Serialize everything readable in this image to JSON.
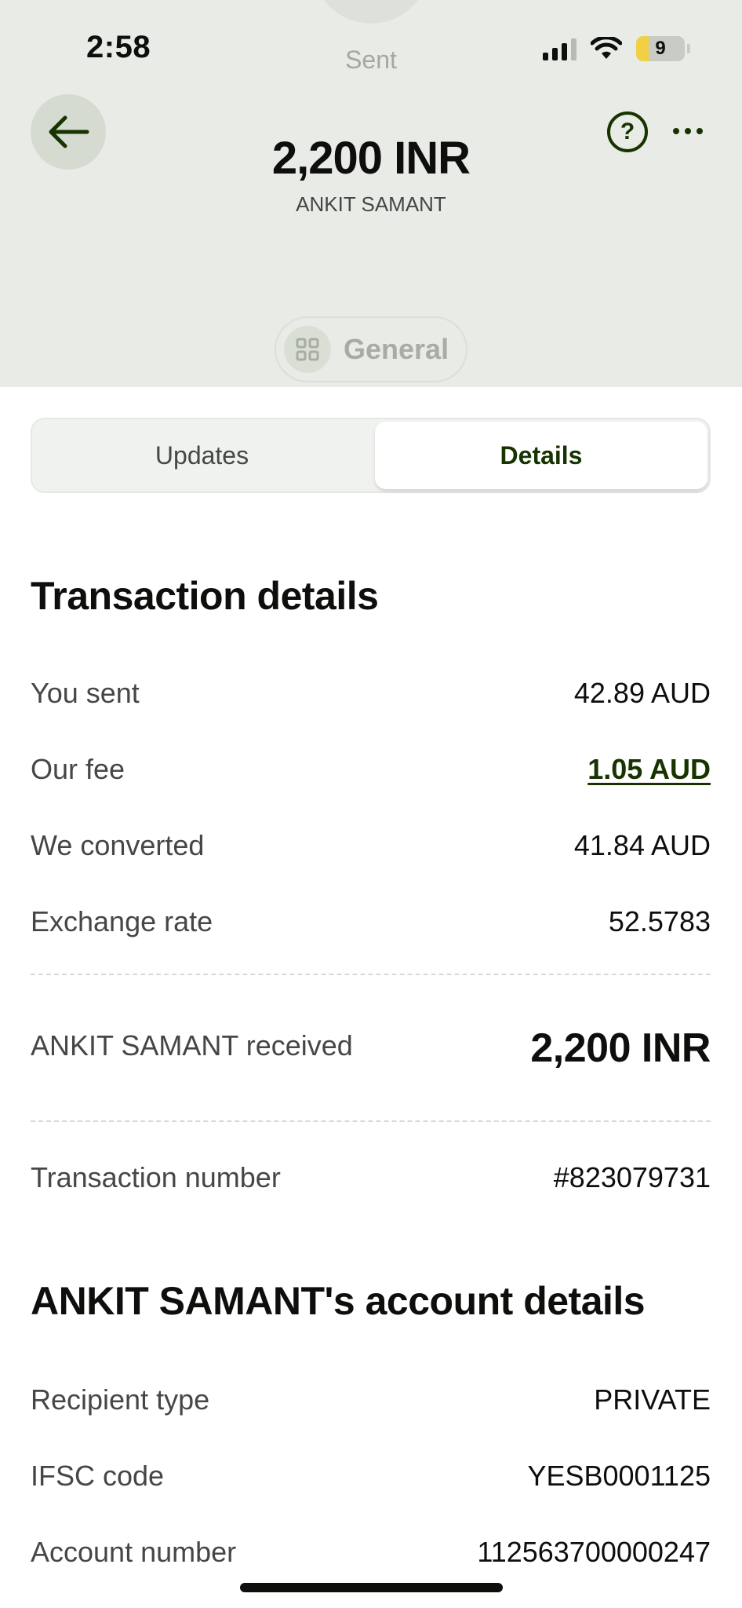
{
  "status_bar": {
    "time": "2:58",
    "battery_level": "9",
    "battery_fraction": 0.09
  },
  "header": {
    "status_label": "Sent",
    "amount": "2,200 INR",
    "recipient": "ANKIT SAMANT",
    "category": "General",
    "back_icon": "arrow-left-icon",
    "help_icon": "question-circle-icon",
    "help_glyph": "?",
    "more_icon": "more-horizontal-icon"
  },
  "tabs": [
    {
      "label": "Updates",
      "selected": false
    },
    {
      "label": "Details",
      "selected": true
    }
  ],
  "transaction_details": {
    "title": "Transaction details",
    "rows": [
      {
        "label": "You sent",
        "value": "42.89 AUD"
      },
      {
        "label": "Our fee",
        "value": "1.05 AUD"
      },
      {
        "label": "We converted",
        "value": "41.84 AUD"
      },
      {
        "label": "Exchange rate",
        "value": "52.5783"
      }
    ],
    "received": {
      "label": "ANKIT SAMANT received",
      "value": "2,200 INR"
    },
    "transaction_number": {
      "label": "Transaction number",
      "value": "#823079731"
    }
  },
  "account_details": {
    "title": "ANKIT SAMANT's account details",
    "rows": [
      {
        "label": "Recipient type",
        "value": "PRIVATE"
      },
      {
        "label": "IFSC code",
        "value": "YESB0001125"
      },
      {
        "label": "Account number",
        "value": "112563700000247"
      }
    ]
  },
  "colors": {
    "header_bg": "#e8ebe6",
    "accent_green": "#163300",
    "text_primary": "#0e0f0c",
    "text_secondary": "#454745"
  }
}
